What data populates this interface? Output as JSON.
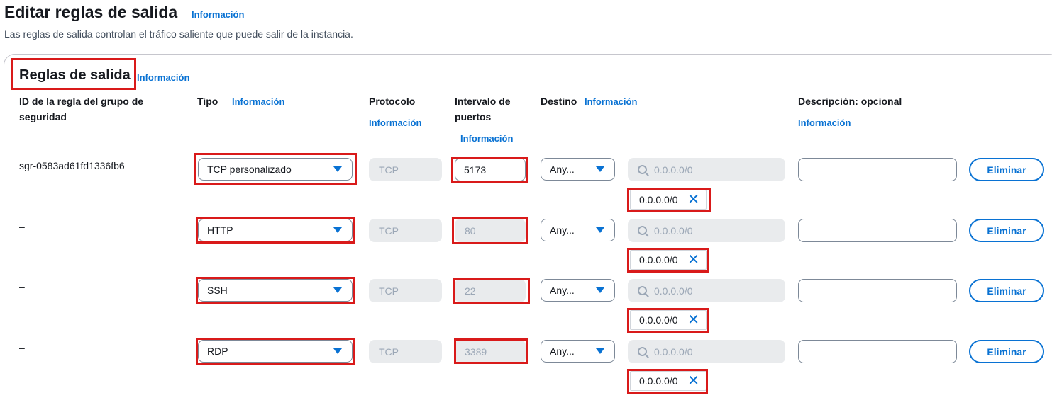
{
  "header": {
    "title": "Editar reglas de salida",
    "info": "Información",
    "description": "Las reglas de salida controlan el tráfico saliente que puede salir de la instancia."
  },
  "section": {
    "title": "Reglas de salida",
    "info": "Información"
  },
  "columns": {
    "rule_id": "ID de la regla del grupo de seguridad",
    "type": "Tipo",
    "type_info": "Información",
    "protocol": "Protocolo",
    "protocol_info": "Información",
    "port_range": "Intervalo de puertos",
    "port_range_info": "Información",
    "destination": "Destino",
    "destination_info": "Información",
    "description": "Descripción: opcional",
    "description_info": "Información"
  },
  "rules": [
    {
      "id": "sgr-0583ad61fd1336fb6",
      "type": "TCP personalizado",
      "protocol": "TCP",
      "port": "5173",
      "destination": "Any...",
      "cidr_placeholder": "0.0.0.0/0",
      "token": "0.0.0.0/0",
      "delete": "Eliminar"
    },
    {
      "id": "–",
      "type": "HTTP",
      "protocol": "TCP",
      "port": "80",
      "destination": "Any...",
      "cidr_placeholder": "0.0.0.0/0",
      "token": "0.0.0.0/0",
      "delete": "Eliminar"
    },
    {
      "id": "–",
      "type": "SSH",
      "protocol": "TCP",
      "port": "22",
      "destination": "Any...",
      "cidr_placeholder": "0.0.0.0/0",
      "token": "0.0.0.0/0",
      "delete": "Eliminar"
    },
    {
      "id": "–",
      "type": "RDP",
      "protocol": "TCP",
      "port": "3389",
      "destination": "Any...",
      "cidr_placeholder": "0.0.0.0/0",
      "token": "0.0.0.0/0",
      "delete": "Eliminar"
    }
  ],
  "colors": {
    "accent": "#0972d3",
    "highlight": "#d91a1a",
    "disabled_bg": "#e9ebed",
    "disabled_text": "#9ba7b6"
  },
  "icons": [
    "search-icon",
    "caret-down-icon",
    "close-icon"
  ]
}
